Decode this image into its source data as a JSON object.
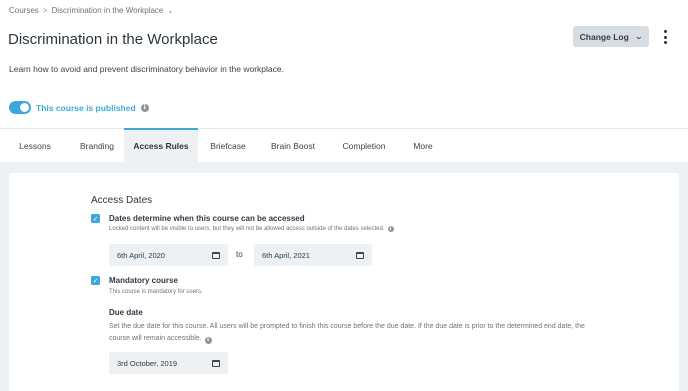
{
  "breadcrumb": {
    "root": "Courses",
    "separator": ">",
    "current": "Discrimination in the Workplace",
    "dropdown_icon": "chevron-down-icon"
  },
  "header": {
    "title": "Discrimination in the Workplace",
    "description": "Learn how to avoid and prevent discriminatory behavior in the workplace.",
    "change_log_label": "Change Log",
    "more_icon": "kebab-menu-icon"
  },
  "publish": {
    "label": "This course is published",
    "enabled": true,
    "color": "#3ca9de"
  },
  "tabs": [
    {
      "label": "Lessons",
      "active": false
    },
    {
      "label": "Branding",
      "active": false
    },
    {
      "label": "Access Rules",
      "active": true
    },
    {
      "label": "Briefcase",
      "active": false
    },
    {
      "label": "Brain Boost",
      "active": false
    },
    {
      "label": "Completion",
      "active": false
    },
    {
      "label": "More",
      "active": false
    }
  ],
  "access_dates": {
    "section_title": "Access Dates",
    "dates_checkbox": {
      "checked": true,
      "label": "Dates determine when this course can be accessed",
      "hint": "Locked content will be visible to users, but they will not be allowed access outside of the dates selected."
    },
    "start_date": "6th April, 2020",
    "to_label": "to",
    "end_date": "6th April, 2021",
    "mandatory_checkbox": {
      "checked": true,
      "label": "Mandatory course",
      "hint": "This course is mandatory for users."
    },
    "due_date": {
      "title": "Due date",
      "description": "Set the due date for this course. All users will be prompted to finish this course before the due date. If the due date is prior to the determined end date, the course will remain accessible.",
      "value": "3rd October, 2019"
    }
  },
  "colors": {
    "accent": "#3ca9de",
    "background_gray": "#edf1f4",
    "button_gray": "#d7dde3"
  }
}
